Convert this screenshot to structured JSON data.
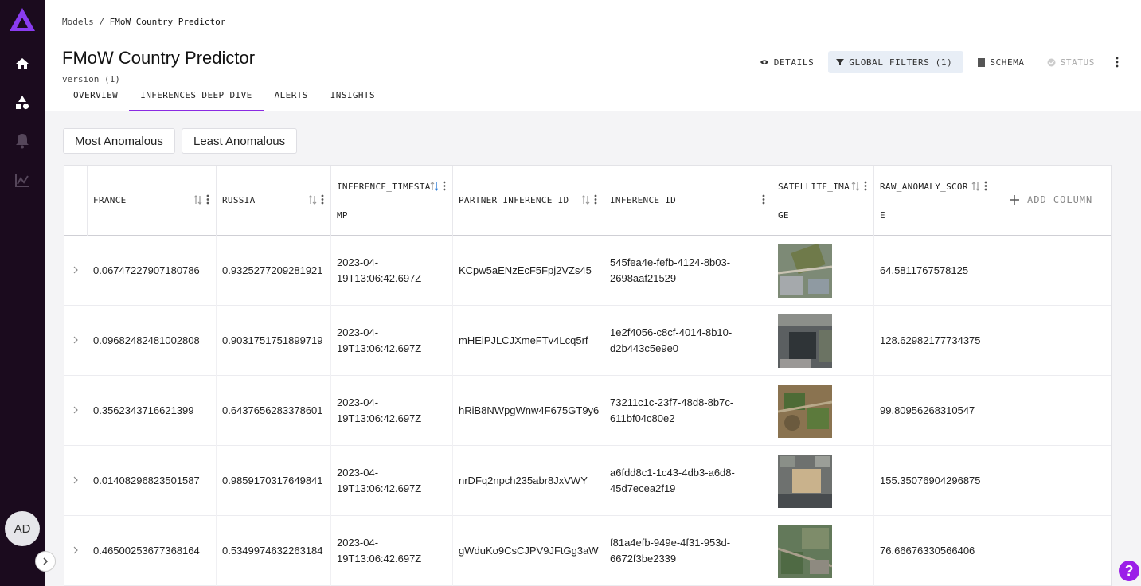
{
  "sidebar": {
    "nav": [
      "home-icon",
      "models-icon",
      "alerts-icon",
      "analytics-icon"
    ],
    "avatar_initials": "AD"
  },
  "header": {
    "breadcrumb_root": "Models",
    "breadcrumb_sep": "/",
    "breadcrumb_current": "FMoW Country Predictor",
    "title": "FMoW Country Predictor",
    "version": "version (1)",
    "tabs": [
      "OVERVIEW",
      "INFERENCES DEEP DIVE",
      "ALERTS",
      "INSIGHTS"
    ],
    "active_tab": "INFERENCES DEEP DIVE",
    "actions": {
      "details": "DETAILS",
      "global_filters": "GLOBAL FILTERS (1)",
      "schema": "SCHEMA",
      "status": "STATUS"
    },
    "accent_color": "#8a2be2"
  },
  "toggles": [
    "Most Anomalous",
    "Least Anomalous"
  ],
  "table": {
    "columns": {
      "france": "FRANCE",
      "russia": "RUSSIA",
      "ts_a": "INFERENCE_TIMESTA",
      "ts_b": "MP",
      "partner": "PARTNER_INFERENCE_ID",
      "inference": "INFERENCE_ID",
      "sat_a": "SATELLITE_IMA",
      "sat_b": "GE",
      "raw_a": "RAW_ANOMALY_SCOR",
      "raw_b": "E"
    },
    "add_column": "ADD COLUMN",
    "rows": [
      {
        "france": "0.06747227907180786",
        "russia": "0.9325277209281921",
        "ts1": "2023-04-",
        "ts2": "19T13:06:42.697Z",
        "partner": "KCpw5aENzEcF5Fpj2VZs45",
        "id1": "545fea4e-fefb-4124-8b03-",
        "id2": "2698aaf21529",
        "raw": "64.5811767578125"
      },
      {
        "france": "0.09682482481002808",
        "russia": "0.9031751751899719",
        "ts1": "2023-04-",
        "ts2": "19T13:06:42.697Z",
        "partner": "mHEiPJLCJXmeFTv4Lcq5rf",
        "id1": "1e2f4056-c8cf-4014-8b10-",
        "id2": "d2b443c5e9e0",
        "raw": "128.62982177734375"
      },
      {
        "france": "0.3562343716621399",
        "russia": "0.6437656283378601",
        "ts1": "2023-04-",
        "ts2": "19T13:06:42.697Z",
        "partner": "hRiB8NWpgWnw4F675GT9y6",
        "id1": "73211c1c-23f7-48d8-8b7c-",
        "id2": "611bf04c80e2",
        "raw": "99.80956268310547"
      },
      {
        "france": "0.01408296823501587",
        "russia": "0.9859170317649841",
        "ts1": "2023-04-",
        "ts2": "19T13:06:42.697Z",
        "partner": "nrDFq2npch235abr8JxVWY",
        "id1": "a6fdd8c1-1c43-4db3-a6d8-",
        "id2": "45d7ecea2f19",
        "raw": "155.35076904296875"
      },
      {
        "france": "0.46500253677368164",
        "russia": "0.5349974632263184",
        "ts1": "2023-04-",
        "ts2": "19T13:06:42.697Z",
        "partner": "gWduKo9CsCJPV9JFtGg3aW",
        "id1": "f81a4efb-949e-4f31-953d-",
        "id2": "6672f3be2339",
        "raw": "76.66676330566406"
      }
    ]
  },
  "help_glyph": "?"
}
